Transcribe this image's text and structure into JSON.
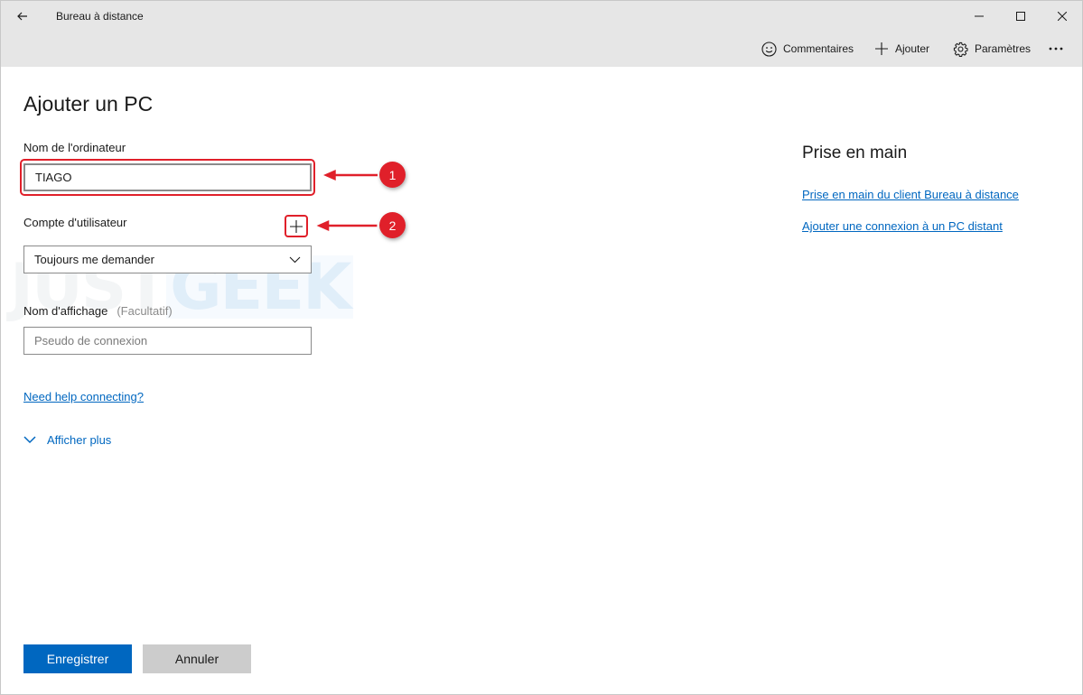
{
  "window": {
    "title": "Bureau à distance"
  },
  "commandbar": {
    "feedback_label": "Commentaires",
    "add_label": "Ajouter",
    "settings_label": "Paramètres"
  },
  "form": {
    "page_title": "Ajouter un PC",
    "computer_name_label": "Nom de l'ordinateur",
    "computer_name_value": "TIAGO",
    "user_account_label": "Compte d'utilisateur",
    "user_account_selected": "Toujours me demander",
    "display_name_label": "Nom d'affichage",
    "display_name_optional": "(Facultatif)",
    "display_name_placeholder": "Pseudo de connexion",
    "help_link": "Need help connecting?",
    "show_more": "Afficher plus"
  },
  "sidebar": {
    "title": "Prise en main",
    "links": [
      "Prise en main du client Bureau à distance",
      "Ajouter une connexion à un PC distant"
    ]
  },
  "footer": {
    "save_label": "Enregistrer",
    "cancel_label": "Annuler"
  },
  "annotations": {
    "badge_1": "1",
    "badge_2": "2",
    "color": "#e0202a"
  },
  "watermark": {
    "part1": "JUST",
    "part2": "GEEK"
  },
  "colors": {
    "accent": "#0067c0",
    "chrome": "#e6e6e6"
  }
}
